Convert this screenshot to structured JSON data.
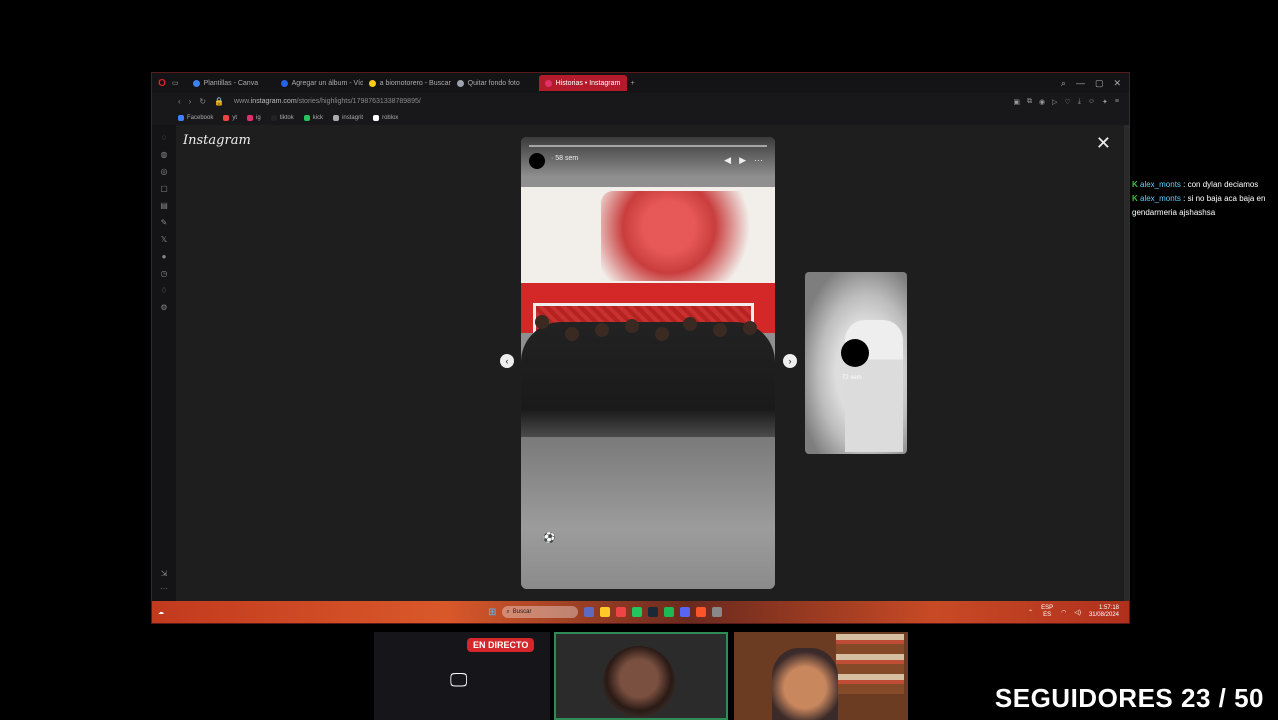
{
  "browser": {
    "tabs": [
      {
        "label": "Plantillas - Canva",
        "color": "#3b82f6",
        "active": false
      },
      {
        "label": "Agregar un álbum - Vídeo",
        "color": "#2563eb",
        "active": false
      },
      {
        "label": "a biomotorero - Buscar con",
        "color": "#facc15",
        "active": false
      },
      {
        "label": "Quitar fondo foto",
        "color": "#9ca3af",
        "active": false
      },
      {
        "label": "Historias • Instagram",
        "color": "#e1306c",
        "active": true
      }
    ],
    "url_prefix": "www.",
    "url_host": "instagram.com",
    "url_path": "/stories/highlights/17987631338789895/",
    "bookmarks": [
      {
        "label": "Facebook",
        "color": "#3b82f6"
      },
      {
        "label": "yt",
        "color": "#ef4444"
      },
      {
        "label": "ig",
        "color": "#e1306c"
      },
      {
        "label": "tiktok",
        "color": "#222222"
      },
      {
        "label": "kick",
        "color": "#22c55e"
      },
      {
        "label": "instagrit",
        "color": "#aaaaaa"
      },
      {
        "label": "roblox",
        "color": "#ffffff"
      }
    ]
  },
  "instagram": {
    "logo": "Instagram",
    "story_user": "· 58 sem",
    "next_user": "72 sem"
  },
  "taskbar": {
    "search_label": "Buscar",
    "lang": "ESP",
    "lang2": "ES",
    "time": "1:57:18",
    "date": "31/08/2024"
  },
  "chat": [
    {
      "user": "alex_monts",
      "message": ": con dylan deciamos"
    },
    {
      "user": "alex_monts",
      "message": ": si no baja aca baja en gendarmeria ajshashsa"
    }
  ],
  "stream": {
    "live_label": "EN DIRECTO",
    "followers": "SEGUIDORES 23 / 50"
  },
  "colors": {
    "live": "#d4262b",
    "chat_user": "#5fd0ff",
    "active_tab": "#b31b2a"
  }
}
